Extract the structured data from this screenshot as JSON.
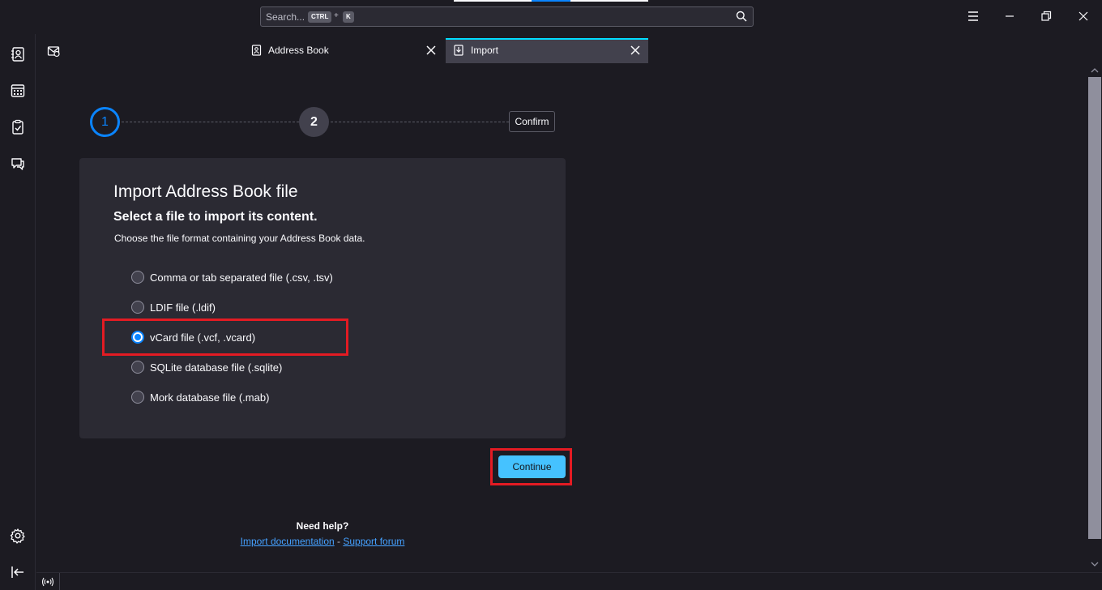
{
  "search": {
    "placeholder": "Search...",
    "kbd_mod": "CTRL",
    "kbd_plus": "+",
    "kbd_key": "K"
  },
  "tabs": [
    {
      "label": "Address Book",
      "icon": "address-book-icon",
      "active": false
    },
    {
      "label": "Import",
      "icon": "import-icon",
      "active": true
    }
  ],
  "steps": {
    "step1": "1",
    "step2": "2",
    "step3": "Confirm"
  },
  "panel": {
    "title": "Import Address Book file",
    "subtitle": "Select a file to import its content.",
    "description": "Choose the file format containing your Address Book data.",
    "options": [
      {
        "label": "Comma or tab separated file (.csv, .tsv)",
        "selected": false
      },
      {
        "label": "LDIF file (.ldif)",
        "selected": false
      },
      {
        "label": "vCard file (.vcf, .vcard)",
        "selected": true
      },
      {
        "label": "SQLite database file (.sqlite)",
        "selected": false
      },
      {
        "label": "Mork database file (.mab)",
        "selected": false
      }
    ]
  },
  "continue_label": "Continue",
  "help": {
    "title": "Need help?",
    "doc_link": "Import documentation",
    "separator": " - ",
    "forum_link": "Support forum"
  },
  "colors": {
    "accent": "#0a84ff",
    "button": "#45c2ff",
    "highlight": "#e31b23"
  }
}
